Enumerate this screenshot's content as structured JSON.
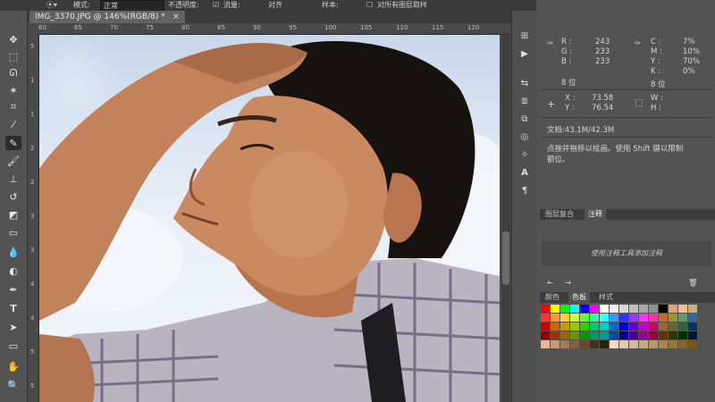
{
  "option_bar": {
    "items": [
      "模式:",
      "正常",
      "不透明度:",
      "流量:",
      "对齐",
      "样本:",
      "对所有图层取样"
    ]
  },
  "document_tab": {
    "title": "IMG_3370.JPG @ 146%(RGB/8) *",
    "close_glyph": "×"
  },
  "ruler": {
    "h_ticks": [
      "60",
      "65",
      "70",
      "75",
      "80",
      "85",
      "90",
      "95",
      "100",
      "105",
      "110",
      "115",
      "120"
    ],
    "v_ticks": [
      "5",
      "1",
      "1",
      "2",
      "2",
      "3",
      "3",
      "4",
      "4",
      "5",
      "5"
    ]
  },
  "info_panel": {
    "rgb": {
      "r_label": "R :",
      "r_value": "243",
      "g_label": "G :",
      "g_value": "233",
      "b_label": "B :",
      "b_value": "233"
    },
    "cmyk": {
      "c_label": "C :",
      "c_value": "7%",
      "m_label": "M :",
      "m_value": "10%",
      "y_label": "Y :",
      "y_value": "70%",
      "k_label": "K :",
      "k_value": "0%"
    },
    "bit_left": "8 位",
    "bit_right": "8 位",
    "xy": {
      "x_label": "X :",
      "x_value": "73.58",
      "y_label": "Y :",
      "y_value": "76.54"
    },
    "wh": {
      "w_label": "W :",
      "w_value": "",
      "h_label": "H :",
      "h_value": ""
    },
    "doc_size": "文档:43.1M/42.3M",
    "hint_line1": "点按并拖移以绘画。使用 Shift 键以限制",
    "hint_line2": "额位。"
  },
  "history_panel": {
    "tabs": [
      "图层复合",
      "注释"
    ],
    "active_tab": 1,
    "empty_text": "使用注释工具添加注释"
  },
  "swatches_panel": {
    "tabs": [
      "颜色",
      "色板",
      "样式"
    ],
    "active_tab": 1,
    "colors": [
      "#ff0000",
      "#ffff00",
      "#00ff00",
      "#00ffff",
      "#0000ff",
      "#ff00ff",
      "#ffffff",
      "#f0f0f0",
      "#d8d8d8",
      "#c0c0c0",
      "#a8a8a8",
      "#909090",
      "#000000",
      "#e8a070",
      "#f0c090",
      "#d0b080",
      "#ff3333",
      "#ff9933",
      "#ffcc33",
      "#ccff33",
      "#66ff33",
      "#33ff99",
      "#33ffff",
      "#3399ff",
      "#3333ff",
      "#9933ff",
      "#ff33ff",
      "#ff3399",
      "#cc6633",
      "#999933",
      "#669966",
      "#336699",
      "#cc0000",
      "#cc6600",
      "#cc9900",
      "#99cc00",
      "#33cc00",
      "#00cc66",
      "#00cccc",
      "#0066cc",
      "#0000cc",
      "#6600cc",
      "#cc00cc",
      "#cc0066",
      "#996633",
      "#666633",
      "#336633",
      "#003366",
      "#990000",
      "#993300",
      "#996600",
      "#669900",
      "#009900",
      "#009966",
      "#009999",
      "#004c99",
      "#000099",
      "#4c0099",
      "#990099",
      "#99004c",
      "#663300",
      "#333300",
      "#003300",
      "#001933",
      "#e8b898",
      "#c89878",
      "#a87858",
      "#886040",
      "#684828",
      "#483018",
      "#282010",
      "#f8d8c8",
      "#e8c8b0",
      "#d8b898",
      "#c8a880",
      "#b89868",
      "#a88850",
      "#987838",
      "#886820",
      "#785810"
    ]
  }
}
